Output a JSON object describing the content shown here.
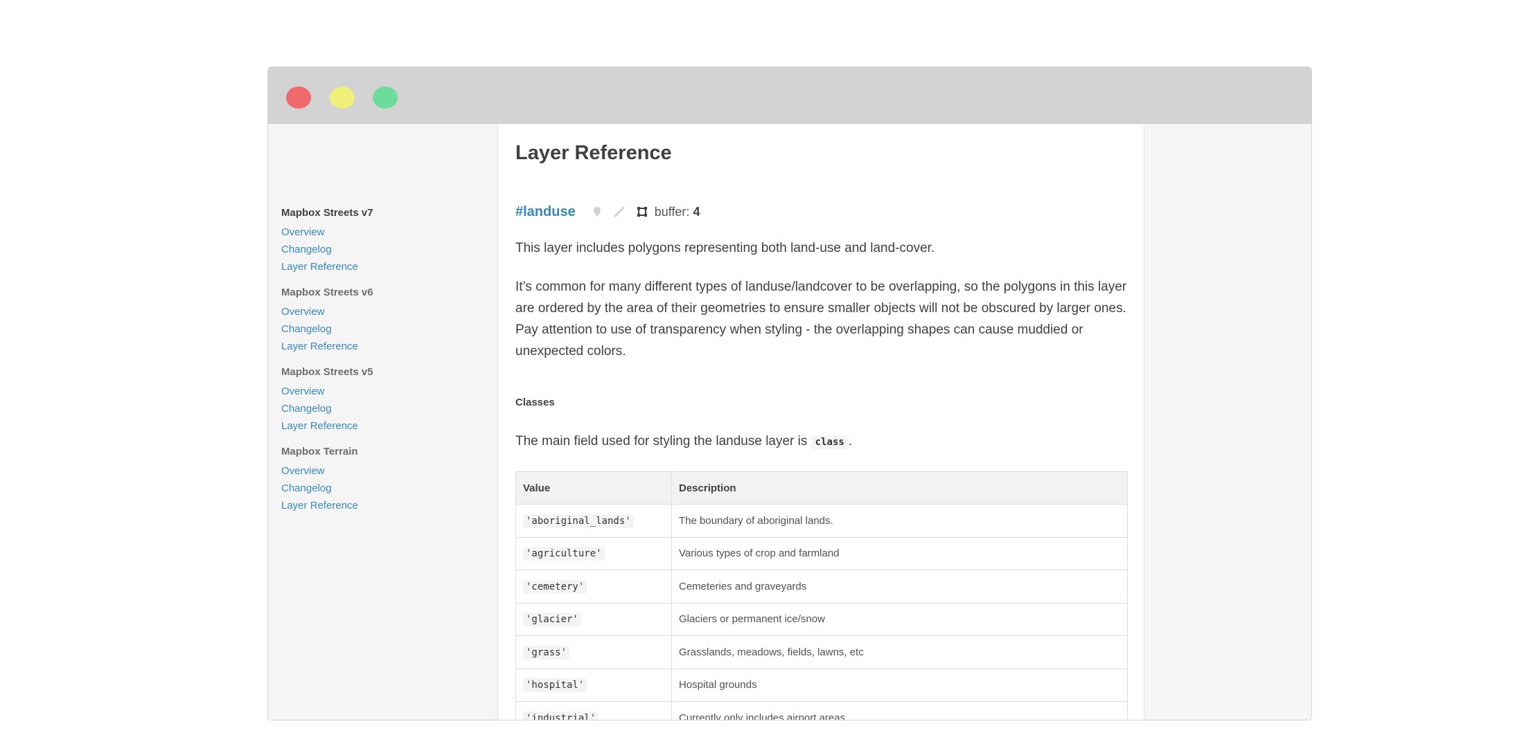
{
  "sidebar": {
    "groups": [
      {
        "heading": "Mapbox Streets v7",
        "links": [
          "Overview",
          "Changelog",
          "Layer Reference"
        ]
      },
      {
        "heading": "Mapbox Streets v6",
        "links": [
          "Overview",
          "Changelog",
          "Layer Reference"
        ]
      },
      {
        "heading": "Mapbox Streets v5",
        "links": [
          "Overview",
          "Changelog",
          "Layer Reference"
        ]
      },
      {
        "heading": "Mapbox Terrain",
        "links": [
          "Overview",
          "Changelog",
          "Layer Reference"
        ]
      }
    ]
  },
  "main": {
    "title": "Layer Reference",
    "layer": {
      "name": "#landuse",
      "buffer_label": "buffer:",
      "buffer_value": "4"
    },
    "paragraphs": [
      "This layer includes polygons representing both land-use and land-cover.",
      "It’s common for many different types of landuse/landcover to be overlapping, so the polygons in this layer are ordered by the area of their geometries to ensure smaller objects will not be obscured by larger ones. Pay attention to use of transparency when styling - the overlapping shapes can cause muddied or unexpected colors."
    ],
    "classes_heading": "Classes",
    "classes_intro_before": "The main field used for styling the landuse layer is ",
    "classes_intro_code": "class",
    "classes_intro_after": ".",
    "table": {
      "headers": [
        "Value",
        "Description"
      ],
      "rows": [
        {
          "value": "'aboriginal_lands'",
          "description": "The boundary of aboriginal lands."
        },
        {
          "value": "'agriculture'",
          "description": "Various types of crop and farmland"
        },
        {
          "value": "'cemetery'",
          "description": "Cemeteries and graveyards"
        },
        {
          "value": "'glacier'",
          "description": "Glaciers or permanent ice/snow"
        },
        {
          "value": "'grass'",
          "description": "Grasslands, meadows, fields, lawns, etc"
        },
        {
          "value": "'hospital'",
          "description": "Hospital grounds"
        },
        {
          "value": "'industrial'",
          "description": "Currently only includes airport areas"
        }
      ]
    }
  },
  "colors": {
    "link": "#3887be",
    "close": "#ef6a6c",
    "minimize": "#eef07a",
    "maximize": "#6ddc9b"
  }
}
